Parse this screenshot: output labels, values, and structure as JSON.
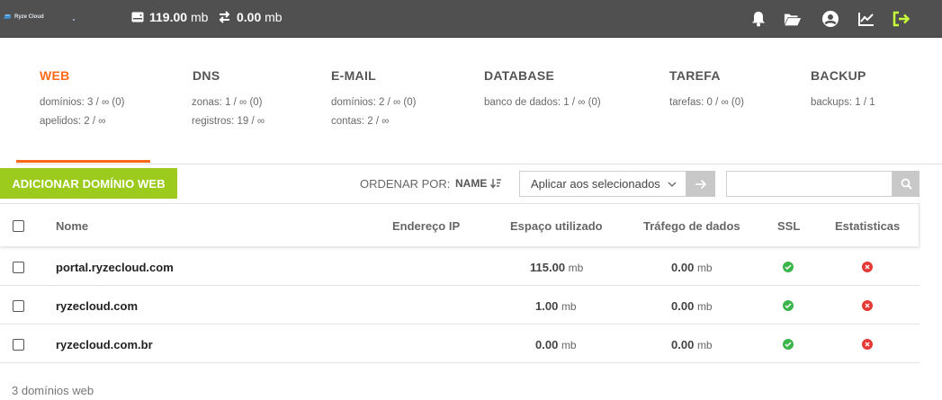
{
  "app": {
    "brand": "Ryze Cloud",
    "disk_usage": {
      "value": "119.00",
      "unit": "mb"
    },
    "traffic": {
      "value": "0.00",
      "unit": "mb"
    },
    "icons": [
      "bell-icon",
      "folder-open-icon",
      "user-circle-icon",
      "line-chart-icon",
      "logout-icon"
    ]
  },
  "tabs": [
    {
      "title": "WEB",
      "lines": [
        "domínios: 3 / ∞ (0)",
        "apelidos: 2 / ∞"
      ],
      "active": true
    },
    {
      "title": "DNS",
      "lines": [
        "zonas: 1 / ∞ (0)",
        "registros: 19 / ∞"
      ]
    },
    {
      "title": "E-MAIL",
      "lines": [
        "domínios: 2 / ∞ (0)",
        "contas: 2 / ∞"
      ]
    },
    {
      "title": "DATABASE",
      "lines": [
        "banco de dados: 1 / ∞ (0)"
      ]
    },
    {
      "title": "TAREFA",
      "lines": [
        "tarefas: 0 / ∞ (0)"
      ]
    },
    {
      "title": "BACKUP",
      "lines": [
        "backups: 1 / 1"
      ]
    }
  ],
  "toolbar": {
    "add_button": "ADICIONAR DOMÍNIO WEB",
    "sort_label": "ORDENAR POR:",
    "sort_value": "NAME",
    "bulk_action": "Aplicar aos selecionados",
    "search_value": ""
  },
  "table": {
    "columns": [
      "Nome",
      "Endereço IP",
      "Espaço utilizado",
      "Tráfego de dados",
      "SSL",
      "Estatisticas"
    ],
    "rows": [
      {
        "name": "portal.ryzecloud.com",
        "ip": "",
        "space": "115.00",
        "space_unit": "mb",
        "traffic": "0.00",
        "traffic_unit": "mb",
        "ssl": "on",
        "stats": "off"
      },
      {
        "name": "ryzecloud.com",
        "ip": "",
        "space": "1.00",
        "space_unit": "mb",
        "traffic": "0.00",
        "traffic_unit": "mb",
        "ssl": "on",
        "stats": "off"
      },
      {
        "name": "ryzecloud.com.br",
        "ip": "",
        "space": "0.00",
        "space_unit": "mb",
        "traffic": "0.00",
        "traffic_unit": "mb",
        "ssl": "on",
        "stats": "off"
      }
    ]
  },
  "footer": {
    "count": "3 domínios web"
  },
  "colors": {
    "accent": "#ff6a1a",
    "primary_button": "#9ccb1e",
    "topbar": "#505050",
    "ok": "#3cb54a",
    "error": "#e53935",
    "logout": "#c6ff3a"
  }
}
